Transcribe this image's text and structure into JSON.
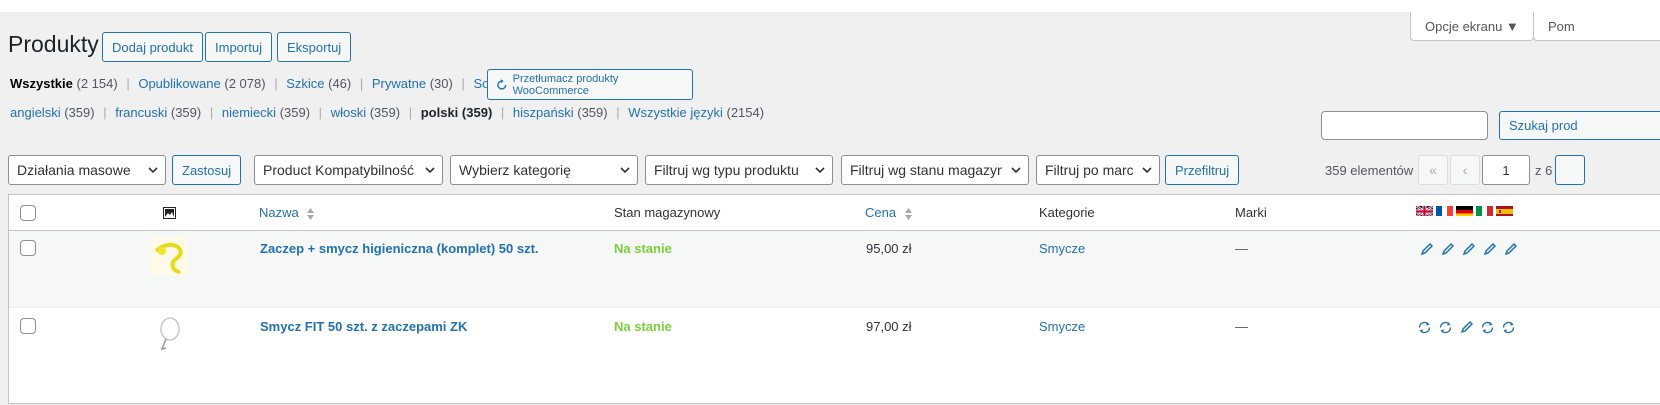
{
  "screen_options": {
    "label": "Opcje ekranu ▼",
    "help_label": "Pom"
  },
  "header": {
    "title": "Produkty",
    "buttons": [
      "Dodaj produkt",
      "Importuj",
      "Eksportuj"
    ]
  },
  "status_filters": [
    {
      "label": "Wszystkie",
      "count": "(2 154)",
      "current": true
    },
    {
      "label": "Opublikowane",
      "count": "(2 078)"
    },
    {
      "label": "Szkice",
      "count": "(46)"
    },
    {
      "label": "Prywatne",
      "count": "(30)"
    },
    {
      "label": "Sortowanie",
      "count": ""
    }
  ],
  "translate_button": "Przetłumacz produkty WooCommerce",
  "language_filters": [
    {
      "label": "angielski",
      "count": "(359)"
    },
    {
      "label": "francuski",
      "count": "(359)"
    },
    {
      "label": "niemiecki",
      "count": "(359)"
    },
    {
      "label": "włoski",
      "count": "(359)"
    },
    {
      "label": "polski",
      "count": "(359)",
      "current": true
    },
    {
      "label": "hiszpański",
      "count": "(359)"
    },
    {
      "label": "Wszystkie języki",
      "count": "(2154)"
    }
  ],
  "search": {
    "value": "",
    "button": "Szukaj prod"
  },
  "filters": {
    "bulk_actions": "Działania masowe",
    "apply": "Zastosuj",
    "compat": "Product Kompatybilność",
    "category": "Wybierz kategorię",
    "product_type": "Filtruj wg typu produktu",
    "stock_status": "Filtruj wg stanu magazynowego",
    "brand": "Filtruj po marce",
    "filter_button": "Przefiltruj"
  },
  "pagination": {
    "count": "359 elementów",
    "first": "«",
    "prev": "‹",
    "current_page": "1",
    "of_text": "z 6"
  },
  "columns": {
    "image_icon": "image-icon",
    "name": "Nazwa",
    "stock": "Stan magazynowy",
    "price": "Cena",
    "categories": "Kategorie",
    "brands": "Marki",
    "flags": [
      "uk-flag-icon",
      "fr-flag-icon",
      "de-flag-icon",
      "it-flag-icon",
      "es-flag-icon"
    ]
  },
  "rows": [
    {
      "name": "Zaczep + smycz higieniczna (komplet) 50 szt.",
      "stock": "Na stanie",
      "price": "95,00 zł",
      "category": "Smycze",
      "brand": "—",
      "actions": [
        "edit",
        "edit",
        "edit",
        "edit",
        "edit"
      ]
    },
    {
      "name": "Smycz FIT 50 szt. z zaczepami ZK",
      "stock": "Na stanie",
      "price": "97,00 zł",
      "category": "Smycze",
      "brand": "—",
      "actions": [
        "sync",
        "sync",
        "edit",
        "sync",
        "sync"
      ]
    }
  ],
  "colors": {
    "link": "#2271b1",
    "instock": "#7ad03a",
    "bg": "#f0f0f1"
  }
}
